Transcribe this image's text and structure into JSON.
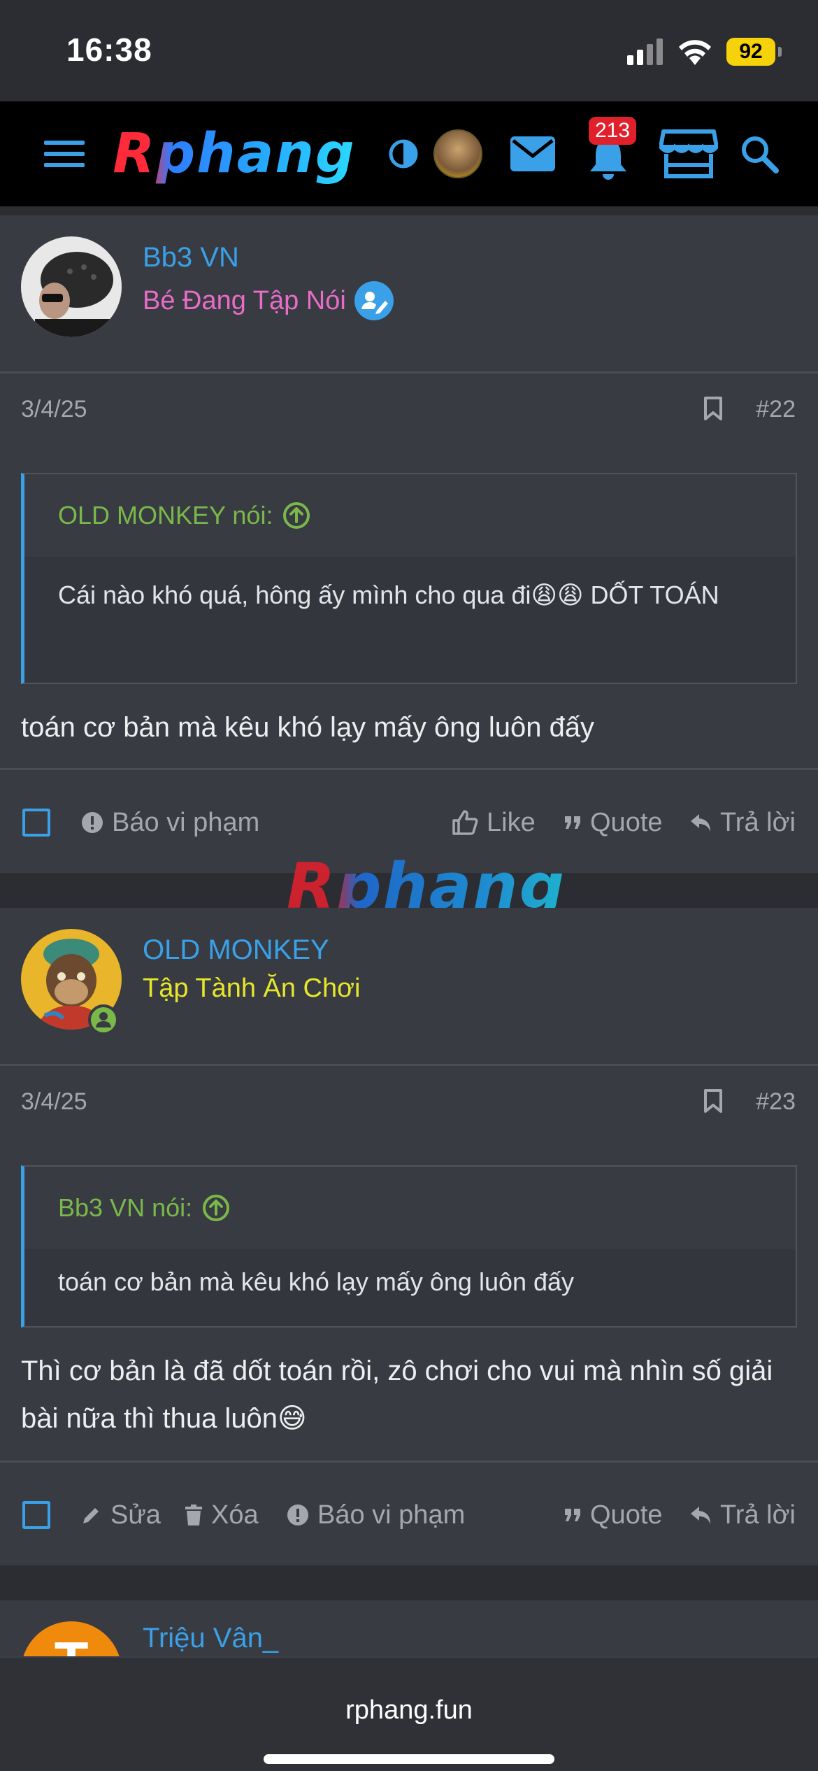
{
  "status_bar": {
    "time": "16:38",
    "battery": "92"
  },
  "header": {
    "logo": "Rphang",
    "notifications_count": "213"
  },
  "watermark": "Rphang",
  "posts": [
    {
      "username": "Bb3 VN",
      "user_title": "Bé Đang Tập Nói",
      "date": "3/4/25",
      "post_number": "#22",
      "quote_author": "OLD MONKEY nói:",
      "quote_text": "Cái nào khó quá, hông ấy mình cho qua đi😩😩 DỐT TOÁN",
      "body": "toán cơ bản mà kêu khó lạy mấy ông luôn đấy",
      "actions": {
        "report": "Báo vi phạm",
        "like": "Like",
        "quote": "Quote",
        "reply": "Trả lời"
      }
    },
    {
      "username": "OLD MONKEY",
      "user_title": "Tập Tành Ăn Chơi",
      "date": "3/4/25",
      "post_number": "#23",
      "quote_author": "Bb3 VN nói:",
      "quote_text": "toán cơ bản mà kêu khó lạy mấy ông luôn đấy",
      "body": "Thì cơ bản là đã dốt toán rồi, zô chơi cho vui mà nhìn số giải bài nữa thì thua luôn😅",
      "actions": {
        "edit": "Sửa",
        "delete": "Xóa",
        "report": "Báo vi phạm",
        "quote": "Quote",
        "reply": "Trả lời"
      }
    },
    {
      "username": "Triệu Vân_",
      "avatar_letter": "T"
    }
  ],
  "browser": {
    "url": "rphang.fun"
  },
  "colors": {
    "accent": "#3aa0e8",
    "title_pink": "#e86cc8",
    "title_yellow": "#e6e62a",
    "quote_green": "#7ab84a"
  }
}
